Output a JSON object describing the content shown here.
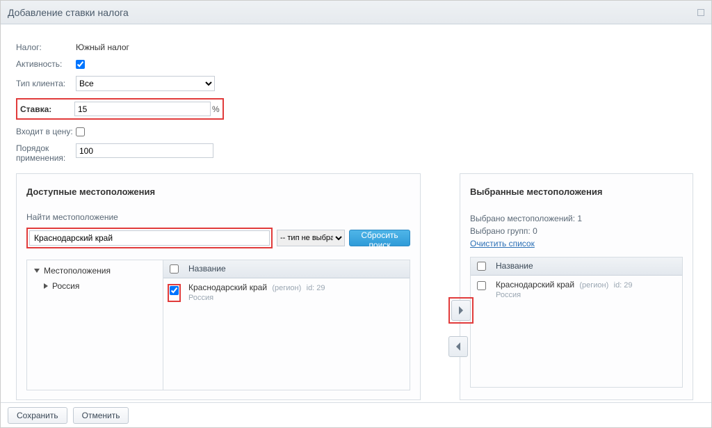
{
  "window": {
    "title": "Добавление ставки налога"
  },
  "form": {
    "tax_label": "Налог:",
    "tax_value": "Южный налог",
    "active_label": "Активность:",
    "active_checked": true,
    "client_type_label": "Тип клиента:",
    "client_type_value": "Все",
    "rate_label": "Ставка:",
    "rate_value": "15",
    "rate_suffix": "%",
    "in_price_label": "Входит в цену:",
    "in_price_checked": false,
    "order_label": "Порядок применения:",
    "order_value": "100"
  },
  "available": {
    "title": "Доступные местоположения",
    "search_label": "Найти местоположение",
    "search_value": "Краснодарский край",
    "type_select": "-- тип не выбран",
    "reset_btn": "Сбросить поиск",
    "tree_root": "Местоположения",
    "tree_child": "Россия",
    "col_name": "Название",
    "row": {
      "checked": true,
      "title": "Краснодарский край",
      "kind": "(регион)",
      "id_label": "id: 29",
      "sub": "Россия"
    }
  },
  "selected": {
    "title": "Выбранные местоположения",
    "count_label": "Выбрано местоположений: 1",
    "groups_label": "Выбрано групп: 0",
    "clear_link": "Очистить список",
    "col_name": "Название",
    "row": {
      "checked": false,
      "title": "Краснодарский край",
      "kind": "(регион)",
      "id_label": "id: 29",
      "sub": "Россия"
    }
  },
  "footer": {
    "save": "Сохранить",
    "cancel": "Отменить"
  }
}
